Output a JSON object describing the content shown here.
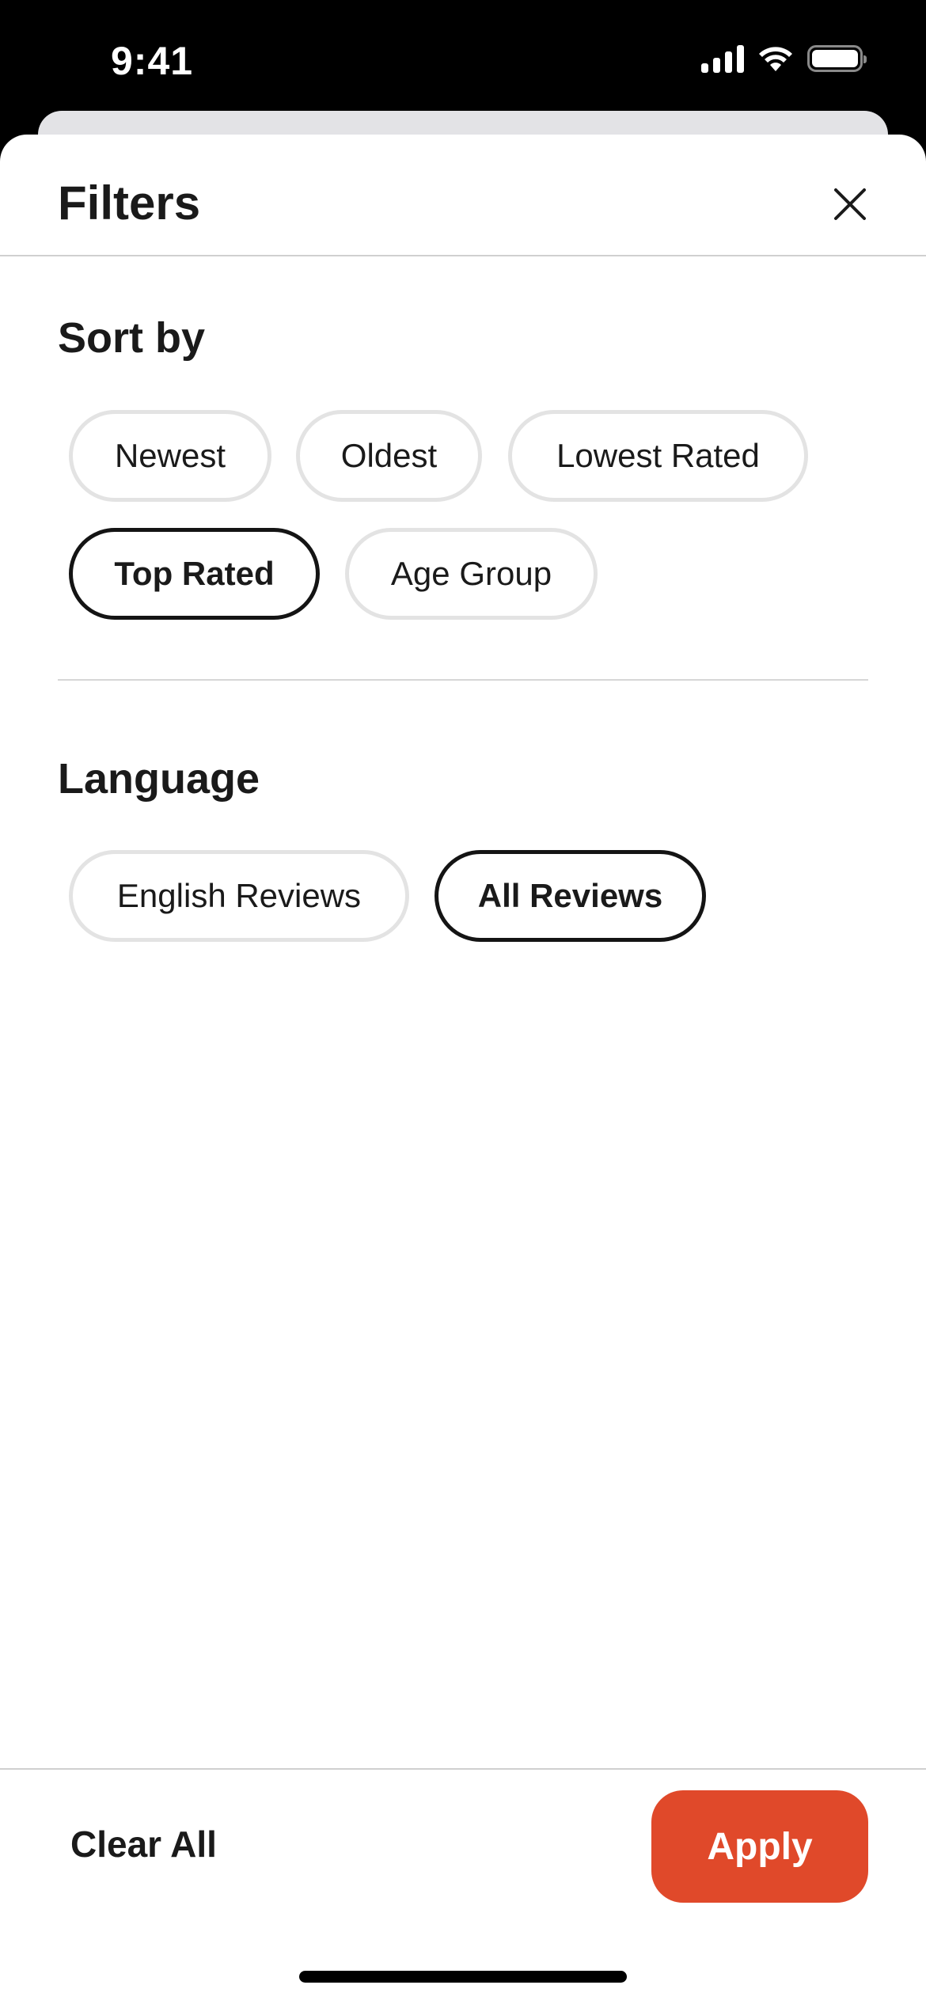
{
  "status_bar": {
    "time": "9:41",
    "icons": [
      "cellular-signal-icon",
      "wifi-icon",
      "battery-icon"
    ]
  },
  "sheet": {
    "title": "Filters",
    "close_icon": "close-icon"
  },
  "sort_by": {
    "title": "Sort by",
    "options": [
      {
        "label": "Newest",
        "selected": false
      },
      {
        "label": "Oldest",
        "selected": false
      },
      {
        "label": "Lowest Rated",
        "selected": false
      },
      {
        "label": "Top Rated",
        "selected": true
      },
      {
        "label": "Age Group",
        "selected": false
      }
    ]
  },
  "language": {
    "title": "Language",
    "options": [
      {
        "label": "English Reviews",
        "selected": false
      },
      {
        "label": "All Reviews",
        "selected": true
      }
    ]
  },
  "footer": {
    "clear_label": "Clear All",
    "apply_label": "Apply"
  },
  "colors": {
    "accent": "#e0492a",
    "selected_border": "#141414",
    "unselected_border": "#e3e3e3"
  }
}
